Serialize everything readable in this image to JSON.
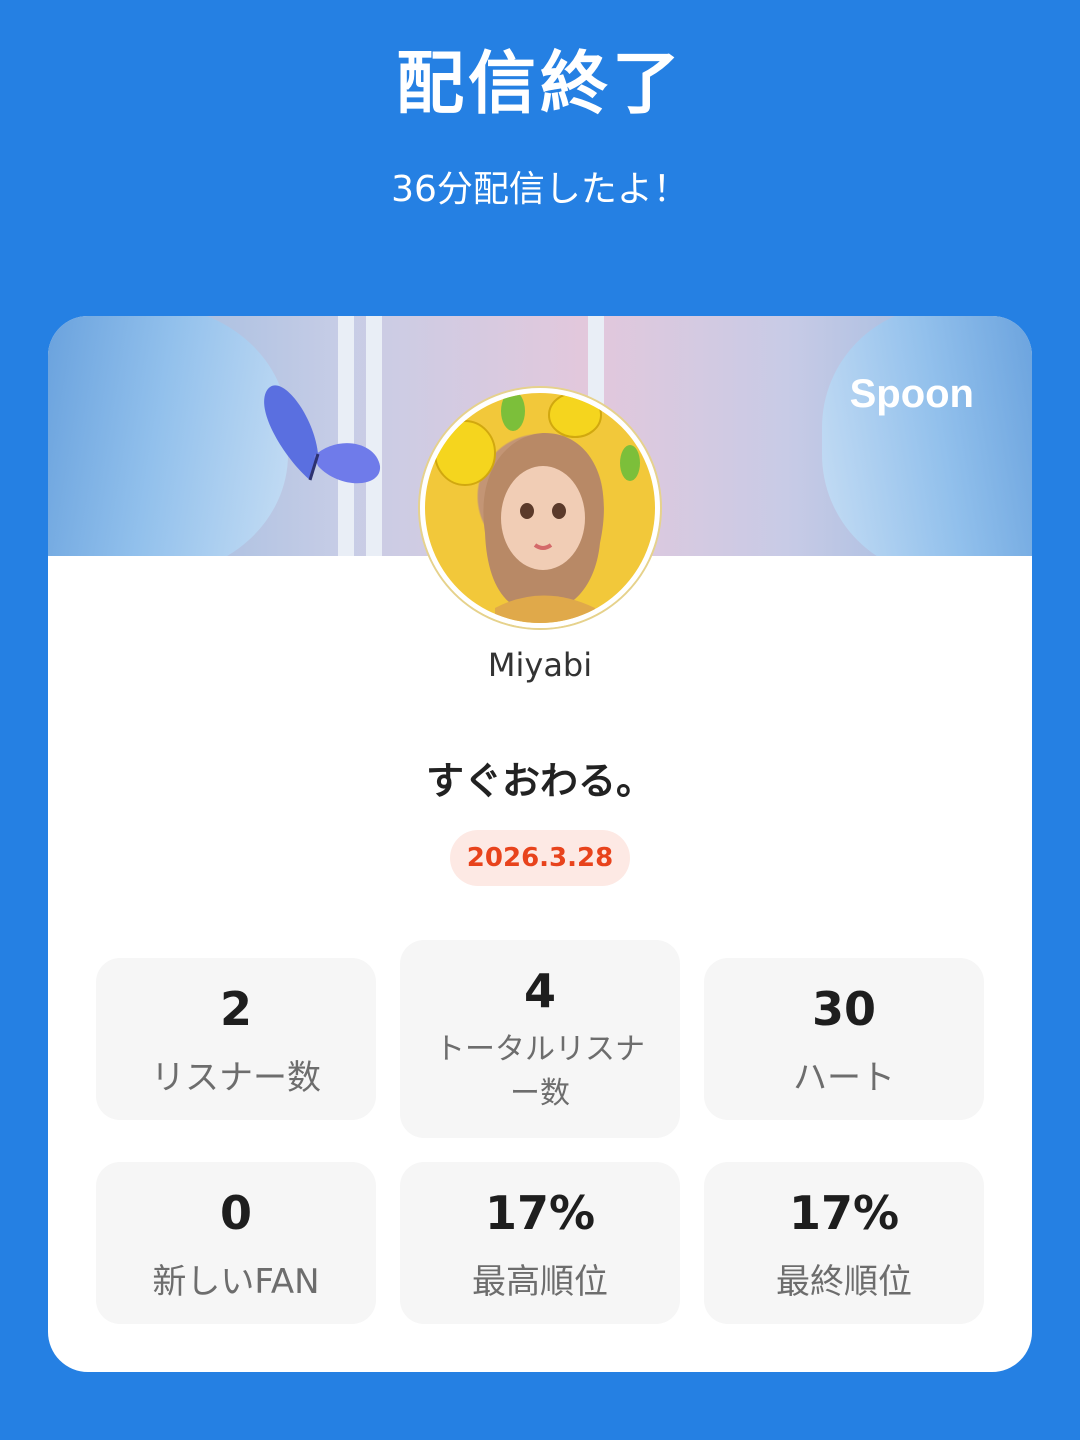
{
  "header": {
    "title": "配信終了",
    "subtitle": "36分配信したよ！"
  },
  "card": {
    "brand": "Spoon",
    "username": "Miyabi",
    "live_title": "すぐおわる。",
    "date": "2026.3.28",
    "stats": [
      {
        "value": "2",
        "label": "リスナー数"
      },
      {
        "value": "4",
        "label_line1": "トータルリスナ",
        "label_line2": "ー数"
      },
      {
        "value": "30",
        "label": "ハート"
      },
      {
        "value": "0",
        "label": "新しいFAN"
      },
      {
        "value": "17%",
        "label": "最高順位"
      },
      {
        "value": "17%",
        "label": "最終順位"
      }
    ]
  },
  "colors": {
    "background": "#2580e3",
    "card": "#ffffff",
    "date_text": "#e8431c",
    "date_badge": "#fde9e4",
    "stat_box": "#f6f6f6"
  }
}
